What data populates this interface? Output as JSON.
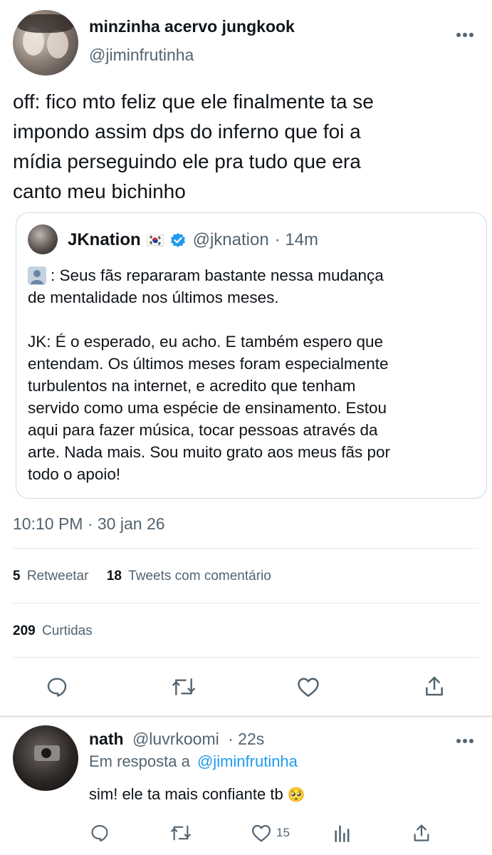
{
  "tweet": {
    "display_name": "minzinha acervo jungkook",
    "handle": "@jiminfrutinha",
    "text_lines": [
      "off: fico mto feliz que ele finalmente ta se",
      "impondo assim dps do inferno que foi a",
      "mídia perseguindo ele pra tudo que era",
      "canto meu bichinho"
    ],
    "timestamp": "10:10 PM · 30 jan 26",
    "retweets_count": "5",
    "retweets_label": "Retweetar",
    "quotes_count": "18",
    "quotes_label": "Tweets com comentário",
    "likes_count": "209",
    "likes_label": "Curtidas"
  },
  "quoted": {
    "display_name": "JKnation",
    "flag": "🇰🇷",
    "handle": "@jknation",
    "time": "· 14m",
    "p1_line1_suffix": ": Seus fãs repararam bastante nessa mudança",
    "p1_line2": "de mentalidade nos últimos meses.",
    "p2_lines": [
      "JK: É o esperado, eu acho. E também espero que",
      "entendam. Os últimos meses foram especialmente",
      "turbulentos na internet, e acredito que tenham",
      "servido como uma espécie de ensinamento. Estou",
      "aqui para fazer música, tocar pessoas através da",
      "arte. Nada mais. Sou muito grato aos meus fãs por",
      "todo o apoio!"
    ]
  },
  "reply": {
    "display_name": "nath",
    "handle": "@luvrkoomi",
    "time": "· 22s",
    "reply_prefix": "Em resposta a",
    "reply_to": "@jiminfrutinha",
    "text": "sim! ele ta mais confiante tb",
    "emoji": "🥺",
    "likes": "15"
  },
  "icons": {
    "more": "more-dots-icon",
    "reply": "reply-icon",
    "retweet": "retweet-icon",
    "like": "heart-icon",
    "share": "share-icon",
    "analytics": "analytics-icon",
    "verified": "verified-badge-icon",
    "person": "person-icon"
  },
  "colors": {
    "accent": "#1d9bf0",
    "muted": "#536471",
    "text": "#0f1419",
    "divider": "#e7e9ea"
  }
}
